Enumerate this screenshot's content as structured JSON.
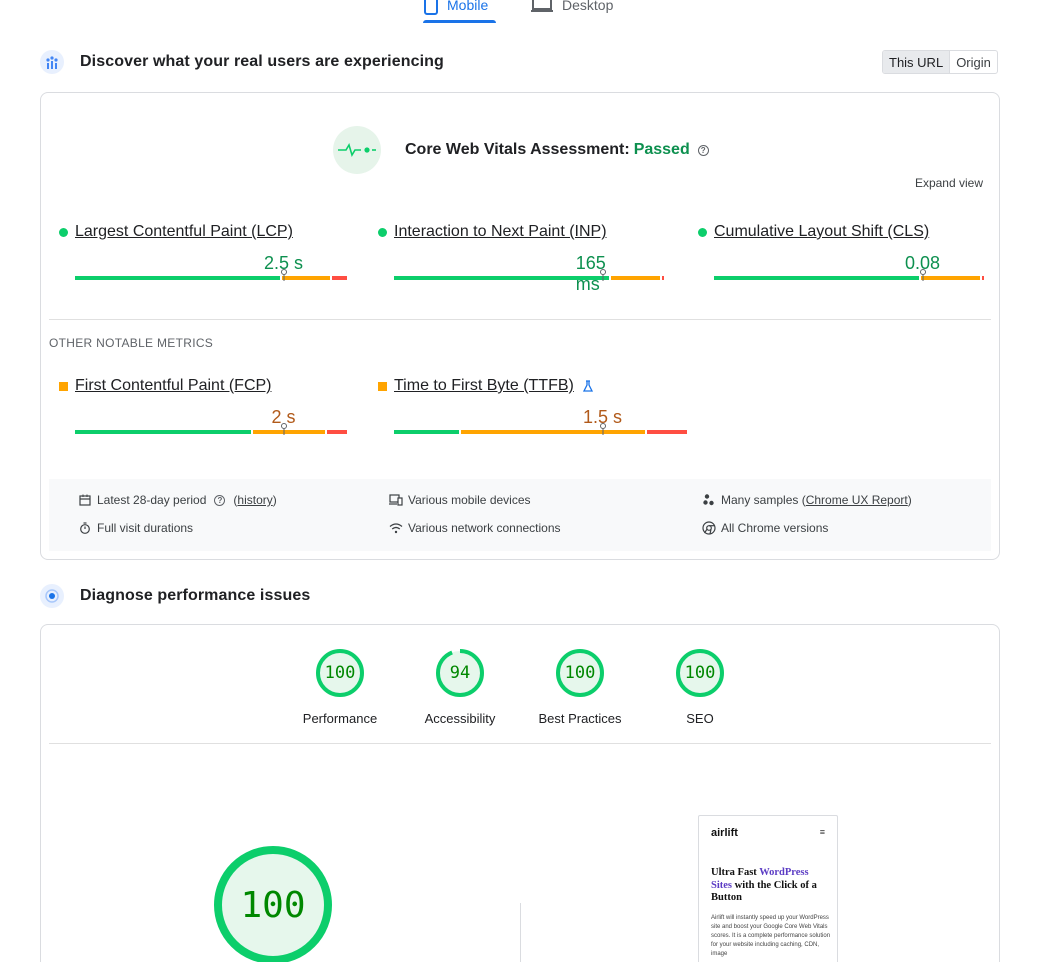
{
  "tabs": {
    "mobile": "Mobile",
    "desktop": "Desktop"
  },
  "field": {
    "title": "Discover what your real users are experiencing",
    "toggle": [
      "This URL",
      "Origin"
    ],
    "assessment_label": "Core Web Vitals Assessment:",
    "assessment_status": "Passed",
    "expand": "Expand view",
    "core_metrics": [
      {
        "name": "Largest Contentful Paint (LCP)",
        "value": "2.5 s",
        "rating": "good",
        "marker": 0.75,
        "segments": [
          0.745,
          0.18,
          0.06
        ]
      },
      {
        "name": "Interaction to Next Paint (INP)",
        "value": "165 ms",
        "rating": "good",
        "marker": 0.75,
        "segments": [
          0.78,
          0.185,
          0.015
        ]
      },
      {
        "name": "Cumulative Layout Shift (CLS)",
        "value": "0.08",
        "rating": "good",
        "marker": 0.75,
        "segments": [
          0.745,
          0.22,
          0.015
        ]
      }
    ],
    "other_title": "OTHER NOTABLE METRICS",
    "other_metrics": [
      {
        "name": "First Contentful Paint (FCP)",
        "value": "2 s",
        "rating": "average",
        "marker": 0.75,
        "segments": [
          0.64,
          0.265,
          0.08
        ]
      },
      {
        "name": "Time to First Byte (TTFB)",
        "value": "1.5 s",
        "rating": "average",
        "marker": 0.75,
        "segments": [
          0.24,
          0.67,
          0.15
        ]
      }
    ],
    "info": {
      "period_label": "Latest 28-day period",
      "history": "history",
      "devices": "Various mobile devices",
      "samples_prefix": "Many samples (",
      "samples_link": "Chrome UX Report",
      "samples_suffix": ")",
      "durations": "Full visit durations",
      "network": "Various network connections",
      "chrome": "All Chrome versions"
    }
  },
  "lab": {
    "title": "Diagnose performance issues",
    "scores": [
      {
        "label": "Performance",
        "value": "100",
        "fraction": 1.0
      },
      {
        "label": "Accessibility",
        "value": "94",
        "fraction": 0.94
      },
      {
        "label": "Best Practices",
        "value": "100",
        "fraction": 1.0
      },
      {
        "label": "SEO",
        "value": "100",
        "fraction": 1.0
      }
    ],
    "big_score": "100",
    "thumbnail": {
      "logo": "airlift",
      "menu": "≡",
      "head_1": "Ultra Fast",
      "head_accent": "WordPress Sites",
      "head_2": "with the Click of a Button",
      "body": "Airlift will instantly speed up your WordPress site and boost your Google Core Web Vitals scores. It is a complete performance solution for your website including caching, CDN, image"
    }
  },
  "colors": {
    "good": "#0cce6b",
    "average": "#ffa400",
    "poor": "#ff4e42",
    "accent": "#1a73e8"
  }
}
